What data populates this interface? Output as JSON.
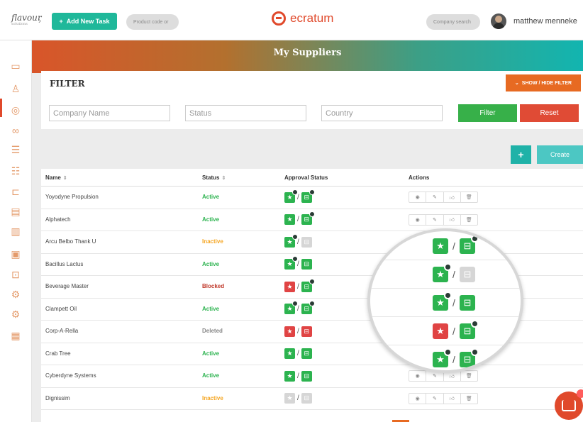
{
  "topbar": {
    "brand": "flavour",
    "brand_sub": "solutions",
    "add_task_label": "Add New Task",
    "product_code_placeholder": "Product code or",
    "logo_text": "ecratum",
    "company_search_placeholder": "Company search",
    "user_name": "matthew menneke"
  },
  "page_title": "My Suppliers",
  "filter": {
    "title": "FILTER",
    "toggle_label": "SHOW / HIDE FILTER",
    "company_placeholder": "Company Name",
    "status_placeholder": "Status",
    "country_placeholder": "Country",
    "filter_label": "Filter",
    "reset_label": "Reset"
  },
  "toolbar": {
    "add_icon": "plus-icon",
    "create_label": "Create"
  },
  "table": {
    "columns": [
      "Name",
      "Status",
      "Approval Status",
      "Actions"
    ],
    "rows": [
      {
        "name": "Yoyodyne Propulsion",
        "status": "Active",
        "star": "green",
        "cart": "green",
        "star_badge": true,
        "cart_badge": true,
        "actions": true
      },
      {
        "name": "Alphatech",
        "status": "Active",
        "star": "green",
        "cart": "green",
        "star_badge": false,
        "cart_badge": true,
        "actions": true
      },
      {
        "name": "Arcu Belbo Thank U",
        "status": "Inactive",
        "star": "green",
        "cart": "grey",
        "star_badge": true,
        "cart_badge": false,
        "actions": false
      },
      {
        "name": "Bacillus Lactus",
        "status": "Active",
        "star": "green",
        "cart": "green",
        "star_badge": true,
        "cart_badge": false,
        "actions": false
      },
      {
        "name": "Beverage Master",
        "status": "Blocked",
        "star": "red",
        "cart": "green",
        "star_badge": false,
        "cart_badge": true,
        "actions": false
      },
      {
        "name": "Clampett Oil",
        "status": "Active",
        "star": "green",
        "cart": "green",
        "star_badge": true,
        "cart_badge": true,
        "actions": false
      },
      {
        "name": "Corp-A-Rella",
        "status": "Deleted",
        "star": "red",
        "cart": "red",
        "star_badge": false,
        "cart_badge": false,
        "actions": false
      },
      {
        "name": "Crab Tree",
        "status": "Active",
        "star": "green",
        "cart": "green",
        "star_badge": false,
        "cart_badge": false,
        "actions": false
      },
      {
        "name": "Cyberdyne Systems",
        "status": "Active",
        "star": "green",
        "cart": "green",
        "star_badge": false,
        "cart_badge": false,
        "actions": true
      },
      {
        "name": "Dignissim",
        "status": "Inactive",
        "star": "grey",
        "cart": "grey",
        "star_badge": false,
        "cart_badge": false,
        "actions": true
      }
    ]
  },
  "magnifier": {
    "rows": [
      {
        "star": "green",
        "cart": "green",
        "star_badge": false,
        "cart_badge": true
      },
      {
        "star": "green",
        "cart": "grey",
        "star_badge": true,
        "cart_badge": false
      },
      {
        "star": "green",
        "cart": "green",
        "star_badge": true,
        "cart_badge": false
      },
      {
        "star": "red",
        "cart": "green",
        "star_badge": false,
        "cart_badge": true
      },
      {
        "star": "green",
        "cart": "green",
        "star_badge": true,
        "cart_badge": true
      }
    ]
  },
  "status_colors": {
    "Active": "#2cb34f",
    "Inactive": "#f5a623",
    "Blocked": "#c0392b",
    "Deleted": "#888888"
  },
  "chat": {
    "icon": "chat-icon"
  }
}
